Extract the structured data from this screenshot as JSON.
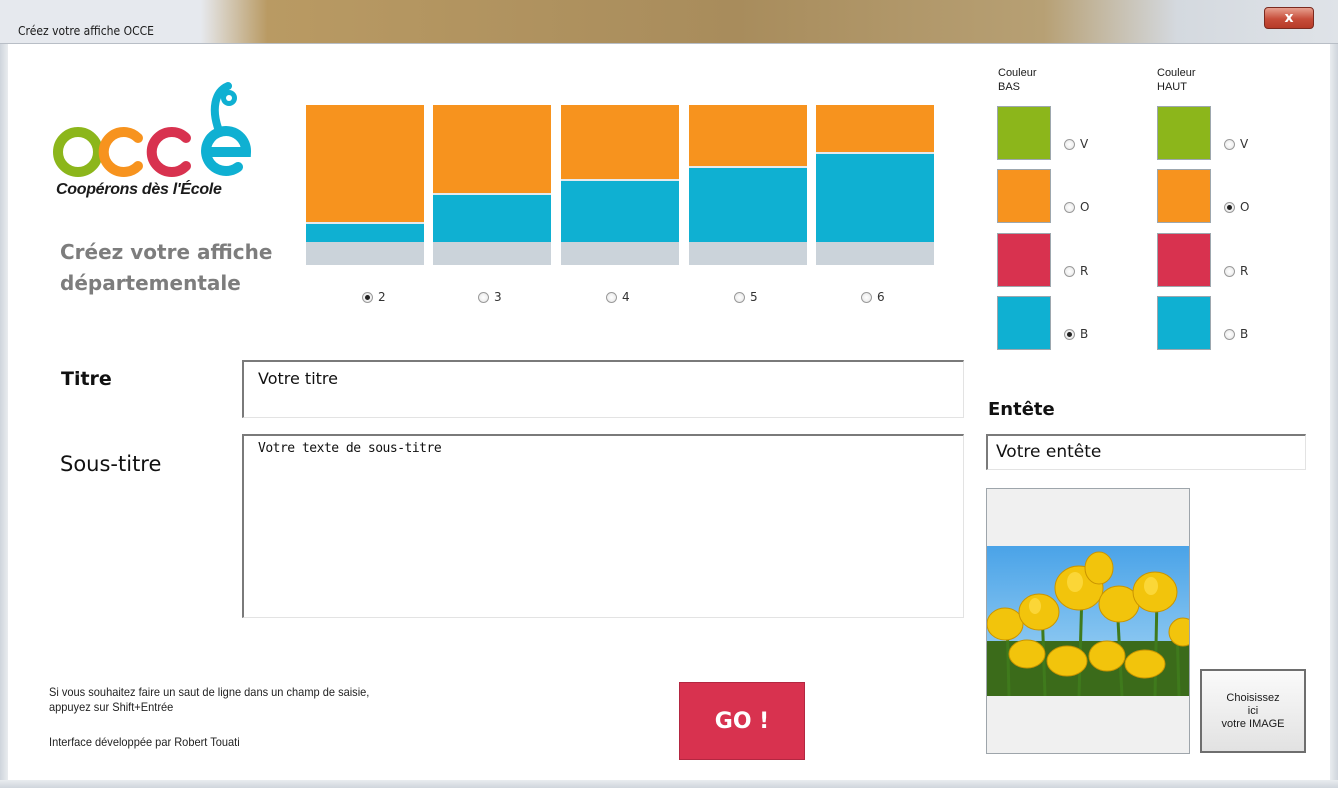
{
  "window": {
    "title": "Créez votre affiche OCCE",
    "close_label": "x"
  },
  "logo": {
    "brand": "occe",
    "tagline": "Coopérons dès l'École"
  },
  "headline": {
    "line1": "Créez votre affiche",
    "line2": "départementale"
  },
  "layout_options": {
    "selected": "2",
    "options": [
      {
        "label": "2",
        "blue_fraction": 0.14
      },
      {
        "label": "3",
        "blue_fraction": 0.35
      },
      {
        "label": "4",
        "blue_fraction": 0.45
      },
      {
        "label": "5",
        "blue_fraction": 0.55
      },
      {
        "label": "6",
        "blue_fraction": 0.65
      }
    ]
  },
  "colors": {
    "V": "#8cb61b",
    "O": "#f7931e",
    "R": "#d8324f",
    "B": "#0fb0d2",
    "grey": "#cbd3da"
  },
  "couleur_bas": {
    "label_line1": "Couleur",
    "label_line2": "BAS",
    "options": [
      "V",
      "O",
      "R",
      "B"
    ],
    "selected": "B"
  },
  "couleur_haut": {
    "label_line1": "Couleur",
    "label_line2": "HAUT",
    "options": [
      "V",
      "O",
      "R",
      "B"
    ],
    "selected": "O"
  },
  "form": {
    "titre_label": "Titre",
    "titre_value": "Votre titre",
    "sous_titre_label": "Sous-titre",
    "sous_titre_value": "Votre texte de sous-titre",
    "entete_label": "Entête",
    "entete_value": "Votre entête"
  },
  "image": {
    "description_icon": "tulips-photo",
    "choose_button": "Choisissez\nici\nvotre IMAGE"
  },
  "go_button": "GO !",
  "notes": {
    "line1": "Si vous souhaitez faire un saut de ligne dans un champ de saisie,",
    "line2": "appuyez sur Shift+Entrée",
    "credit": "Interface développée par Robert Touati"
  }
}
